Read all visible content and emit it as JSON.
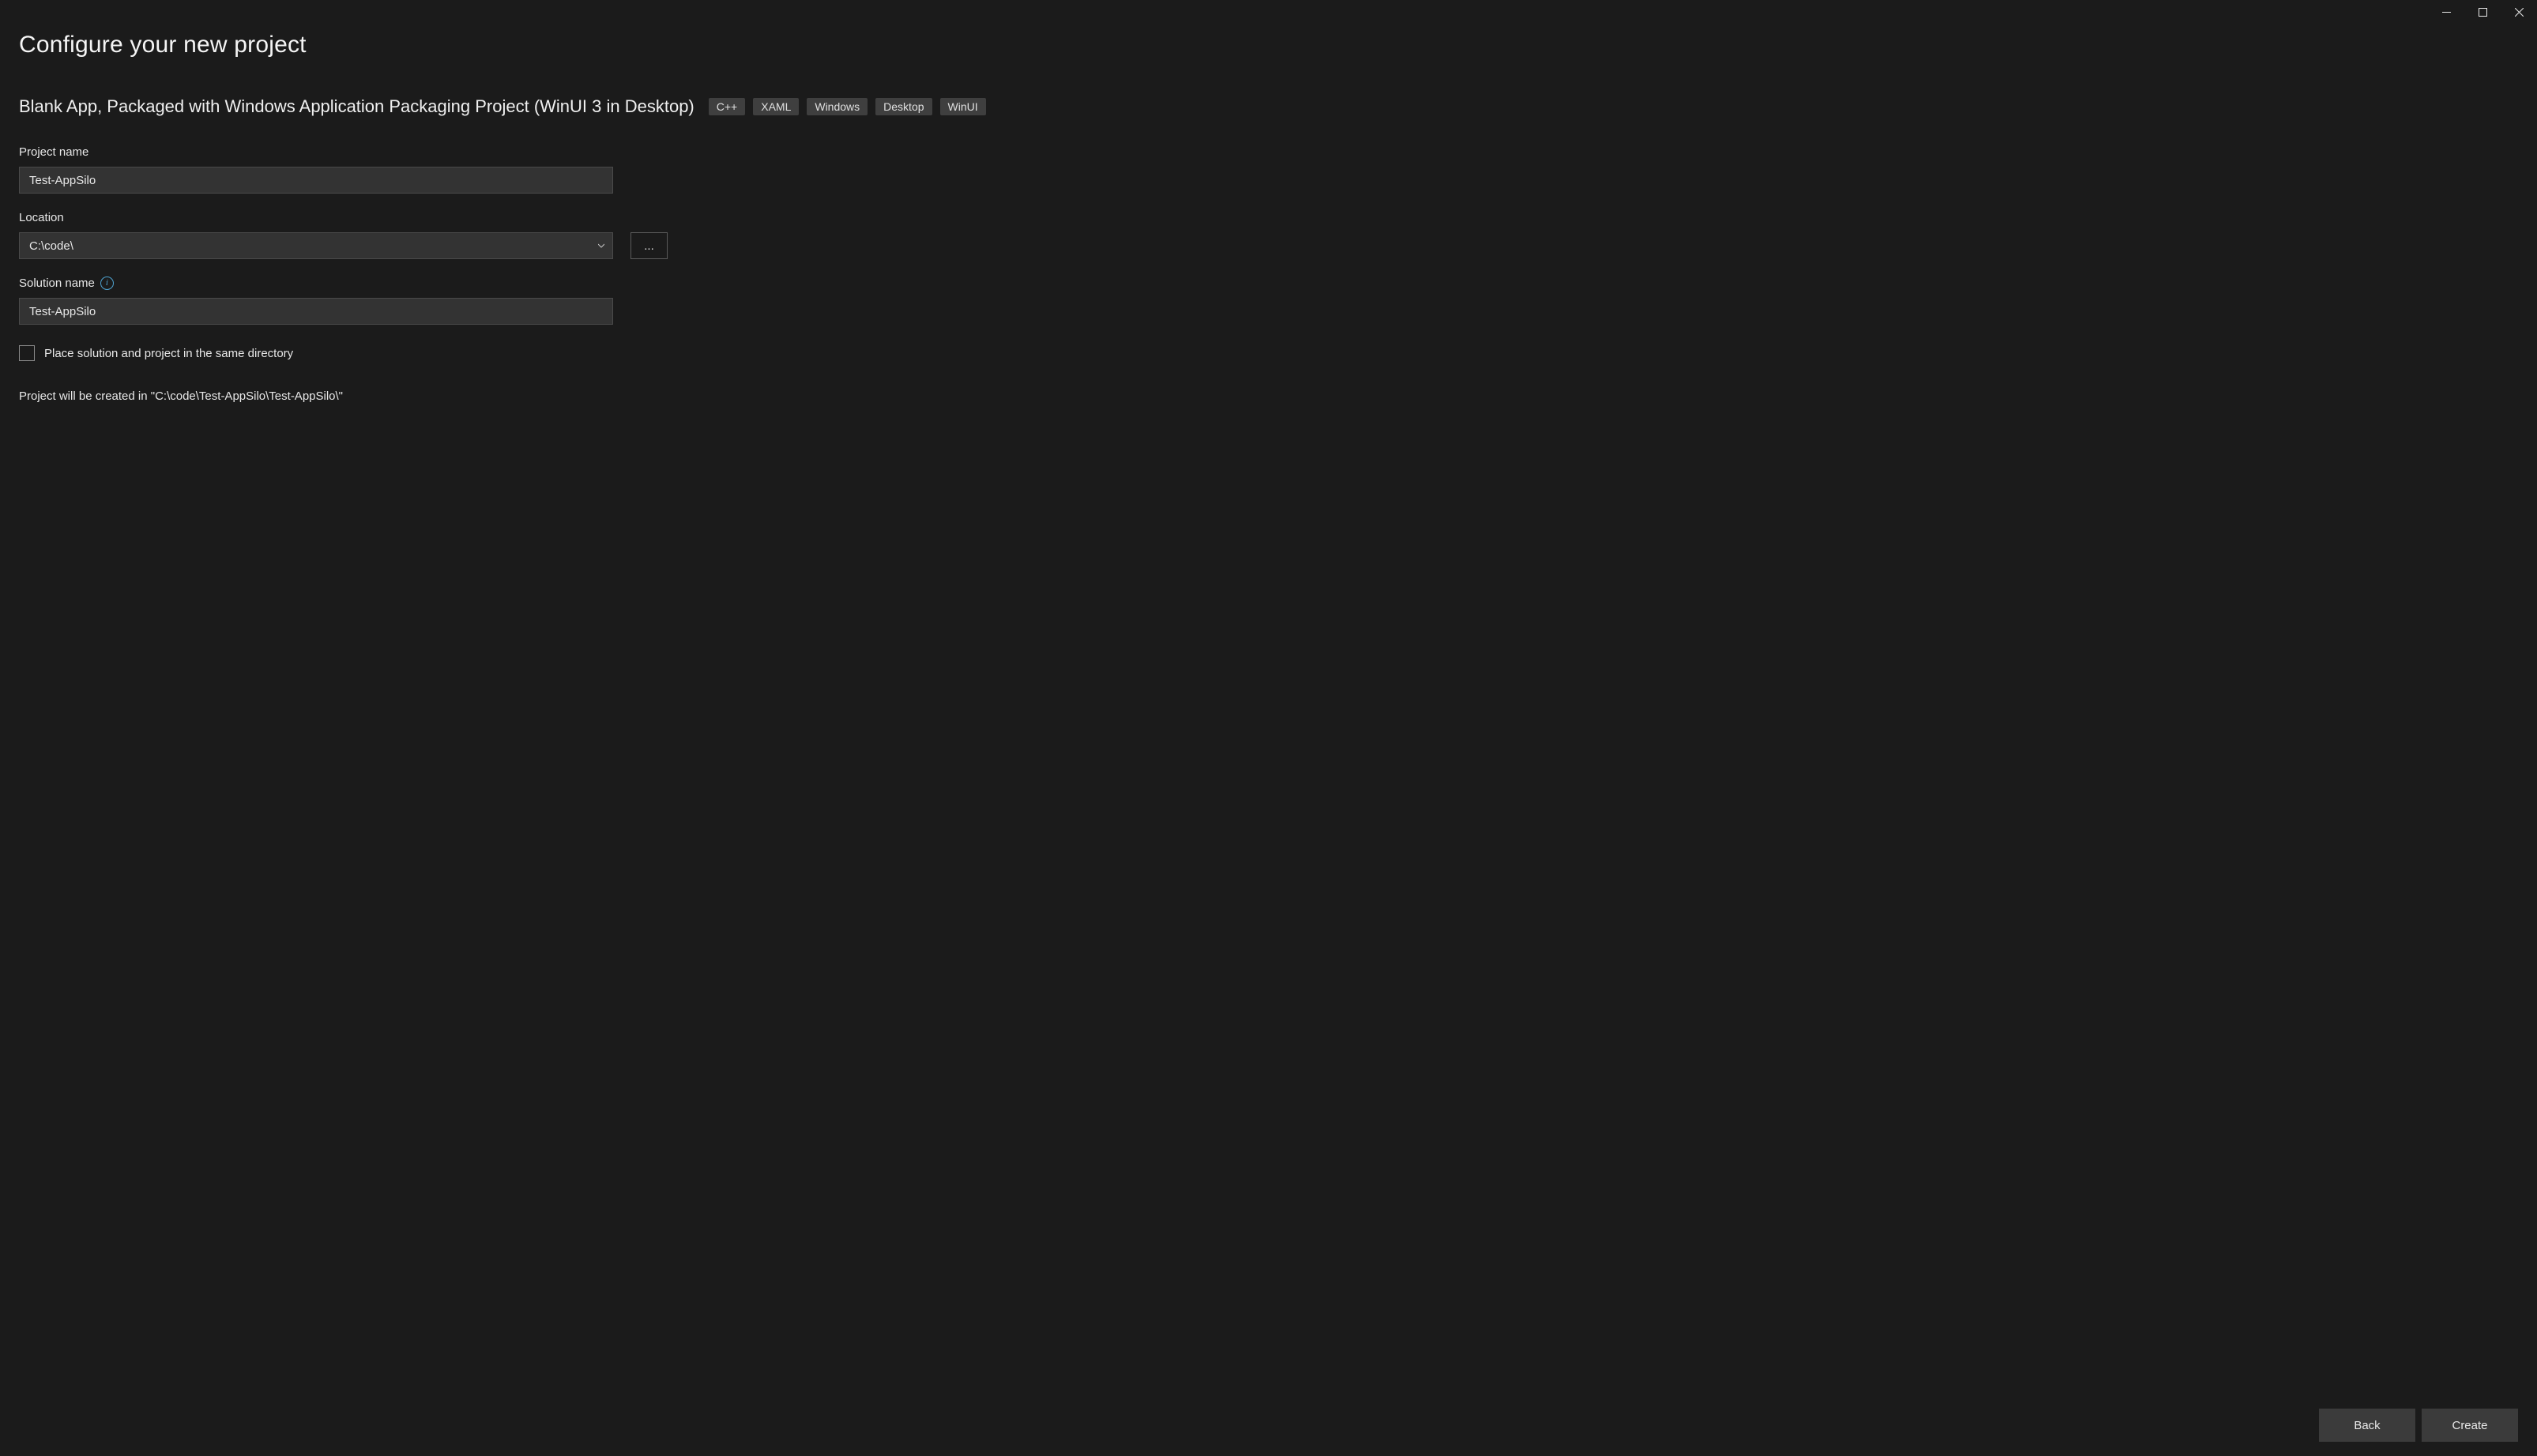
{
  "page": {
    "title": "Configure your new project"
  },
  "template": {
    "name": "Blank App, Packaged with Windows Application Packaging Project (WinUI 3 in Desktop)",
    "tags": [
      "C++",
      "XAML",
      "Windows",
      "Desktop",
      "WinUI"
    ]
  },
  "fields": {
    "project_name": {
      "label": "Project name",
      "value": "Test-AppSilo"
    },
    "location": {
      "label": "Location",
      "value": "C:\\code\\",
      "browse_label": "..."
    },
    "solution_name": {
      "label": "Solution name",
      "value": "Test-AppSilo"
    },
    "same_dir_checkbox": {
      "label": "Place solution and project in the same directory",
      "checked": false
    },
    "creation_path_text": "Project will be created in \"C:\\code\\Test-AppSilo\\Test-AppSilo\\\""
  },
  "footer": {
    "back": "Back",
    "create": "Create"
  }
}
